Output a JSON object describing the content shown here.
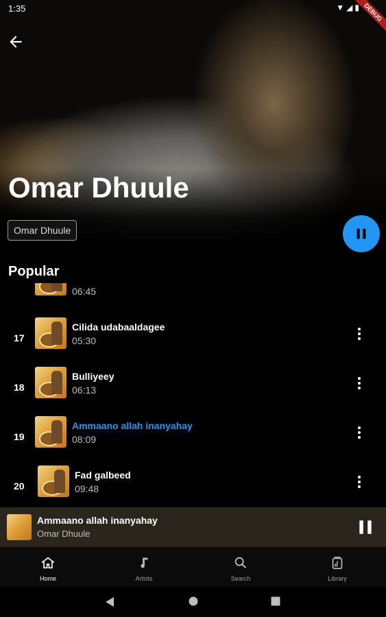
{
  "status_bar": {
    "time": "1:35",
    "debug_label": "DEBUG"
  },
  "artist": {
    "name": "Omar Dhuule",
    "chip": "Omar Dhuule"
  },
  "section_title": "Popular",
  "partial_row": {
    "duration": "06:45"
  },
  "tracks": [
    {
      "number": "17",
      "title": "Cilida udabaaldagee",
      "duration": "05:30",
      "active": false
    },
    {
      "number": "18",
      "title": "Bulliyeey",
      "duration": "06:13",
      "active": false
    },
    {
      "number": "19",
      "title": "Ammaano allah inanyahay",
      "duration": "08:09",
      "active": true
    },
    {
      "number": "20",
      "title": "Fad galbeed",
      "duration": "09:48",
      "active": false
    }
  ],
  "mini_player": {
    "title": "Ammaano allah inanyahay",
    "artist": "Omar Dhuule"
  },
  "bottom_nav": [
    {
      "label": "Home",
      "icon": "home-icon",
      "selected": true
    },
    {
      "label": "Artists",
      "icon": "music-note-icon",
      "selected": false
    },
    {
      "label": "Search",
      "icon": "search-icon",
      "selected": false
    },
    {
      "label": "Library",
      "icon": "library-icon",
      "selected": false
    }
  ],
  "colors": {
    "accent": "#2196f3",
    "background": "#000000",
    "mini_player_bg": "#2a261d"
  }
}
